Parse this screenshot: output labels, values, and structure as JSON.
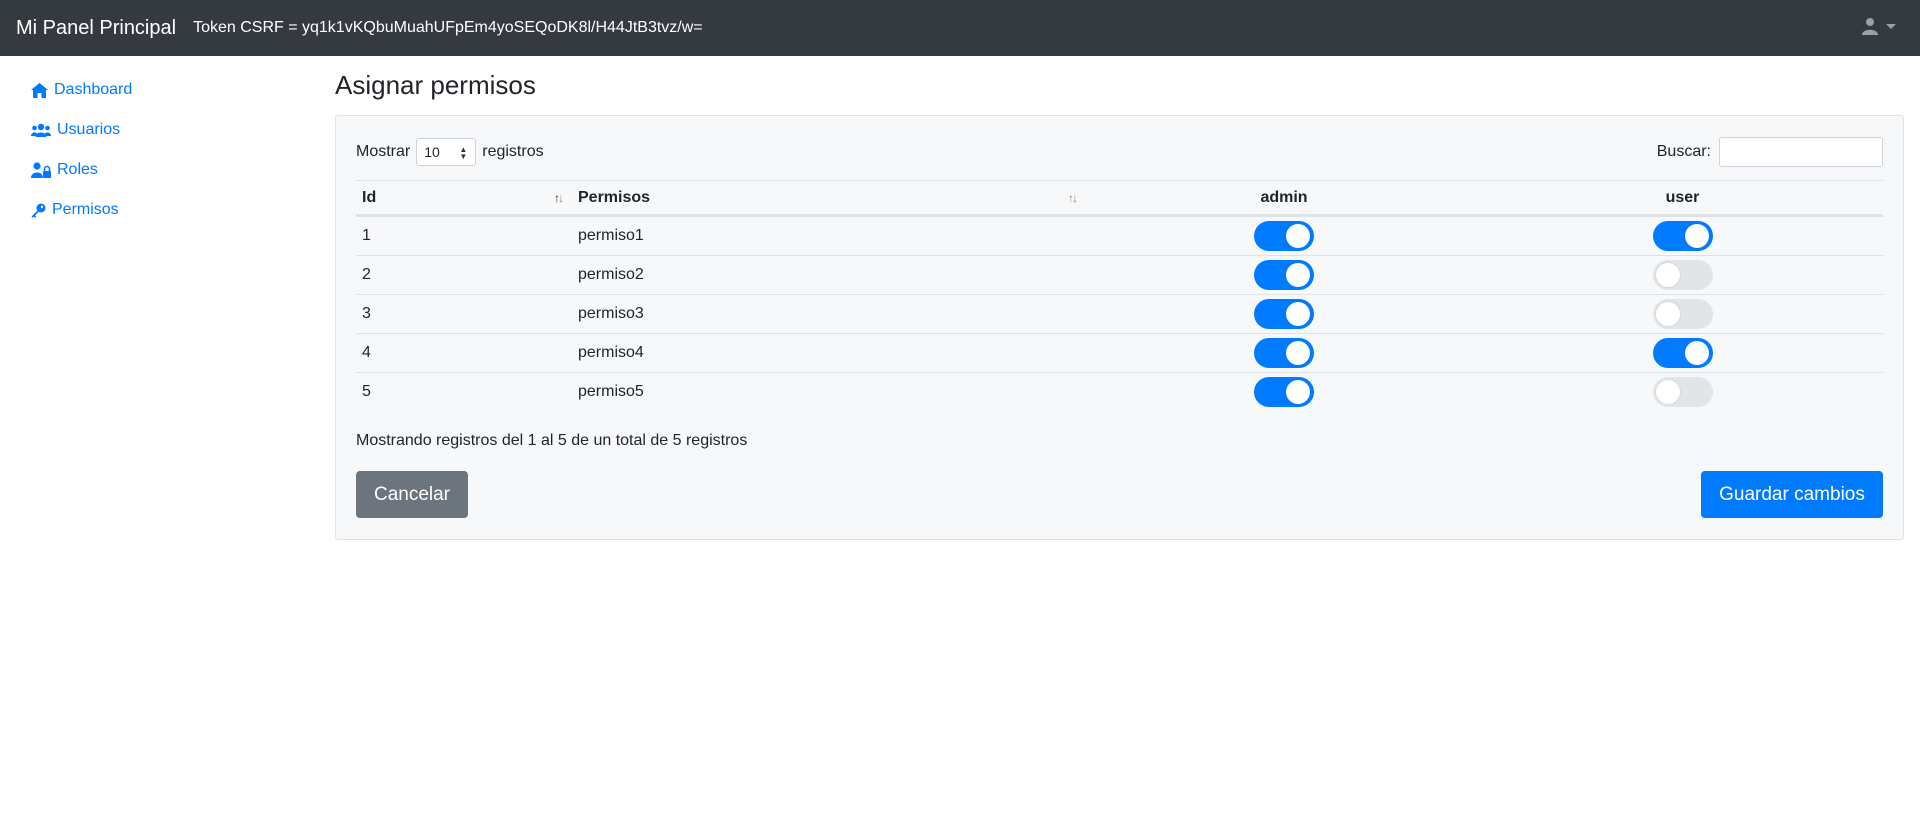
{
  "navbar": {
    "brand": "Mi Panel Principal",
    "token": "Token CSRF = yq1k1vKQbuMuahUFpEm4yoSEQoDK8l/H44JtB3tvz/w=",
    "user_icon": "user-icon"
  },
  "sidebar": {
    "items": [
      {
        "label": "Dashboard",
        "icon": "home-icon"
      },
      {
        "label": "Usuarios",
        "icon": "users-icon"
      },
      {
        "label": "Roles",
        "icon": "user-lock-icon"
      },
      {
        "label": "Permisos",
        "icon": "key-icon"
      }
    ]
  },
  "main": {
    "title": "Asignar permisos",
    "length": {
      "prefix": "Mostrar",
      "value": "10",
      "suffix": "registros"
    },
    "search": {
      "label": "Buscar:",
      "value": ""
    },
    "table": {
      "headers": [
        "Id",
        "Permisos",
        "admin",
        "user"
      ],
      "rows": [
        {
          "id": "1",
          "permiso": "permiso1",
          "admin": true,
          "user": true
        },
        {
          "id": "2",
          "permiso": "permiso2",
          "admin": true,
          "user": false
        },
        {
          "id": "3",
          "permiso": "permiso3",
          "admin": true,
          "user": false
        },
        {
          "id": "4",
          "permiso": "permiso4",
          "admin": true,
          "user": true
        },
        {
          "id": "5",
          "permiso": "permiso5",
          "admin": true,
          "user": false
        }
      ]
    },
    "info": "Mostrando registros del 1 al 5 de un total de 5 registros",
    "buttons": {
      "cancel": "Cancelar",
      "save": "Guardar cambios"
    }
  },
  "colors": {
    "accent": "#007bff",
    "navbar": "#343a40",
    "secondary": "#6c757d"
  }
}
